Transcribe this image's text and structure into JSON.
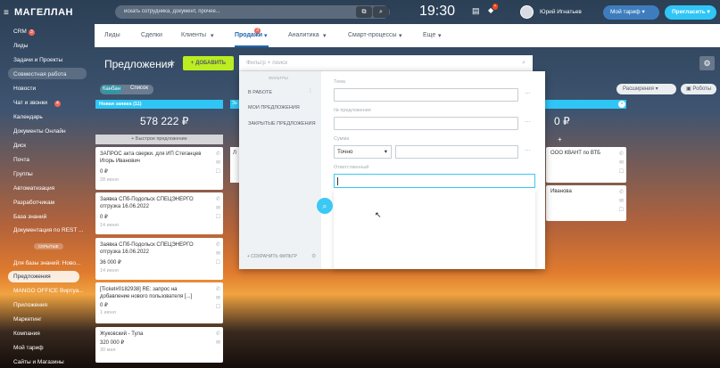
{
  "header": {
    "logo": "МАГЕЛЛАН",
    "search_placeholder": "искать сотрудника, документ, прочее...",
    "clock": "19:30",
    "user_name": "Юрий Игнатьев",
    "tariff_label": "Мой тариф",
    "invite_label": "Пригласить"
  },
  "sidebar": {
    "items": [
      {
        "label": "CRM",
        "badge": "3"
      },
      {
        "label": "Лиды"
      },
      {
        "label": "Задачи и Проекты"
      },
      {
        "label": "Совместная работа"
      },
      {
        "label": "Новости"
      },
      {
        "label": "Чат и звонки",
        "badge": "4"
      },
      {
        "label": "Календарь"
      },
      {
        "label": "Документы Онлайн"
      },
      {
        "label": "Диск"
      },
      {
        "label": "Почта"
      },
      {
        "label": "Группы"
      },
      {
        "label": "Автоматизация"
      },
      {
        "label": "Разработчикам"
      },
      {
        "label": "База знаний"
      },
      {
        "label": "Документация по REST ..."
      },
      {
        "label": "Для базы знаний: Ново..."
      },
      {
        "label": "Предложения"
      },
      {
        "label": "MANGO OFFICE Виртуа..."
      },
      {
        "label": "Приложения"
      },
      {
        "label": "Маркетинг"
      },
      {
        "label": "Компания"
      },
      {
        "label": "Мой тариф"
      },
      {
        "label": "Сайты и Магазины"
      }
    ],
    "hidden_label": "СКРЫТЫЕ"
  },
  "nav": {
    "items": [
      "Лиды",
      "Сделки",
      "Клиенты",
      "Продажи",
      "Аналитика",
      "Смарт-процессы",
      "Еще"
    ],
    "deals_badge": "3"
  },
  "page": {
    "title": "Предложения",
    "add_label": "ДОБАВИТЬ",
    "filter_placeholder": "Фильтр + поиск",
    "view_kanban": "Канбан",
    "view_list": "Список",
    "extensions_label": "Расширения",
    "robots_label": "Роботы"
  },
  "column": {
    "title": "Новая заявка",
    "count": "(11)",
    "total": "578 222 ₽",
    "quick_add": "+ Быстрое предложение"
  },
  "mid_column": {
    "title": "За",
    "card_letter": "Л"
  },
  "cards": [
    {
      "title": "ЗАПРОС акта сверки. для ИП Стеганцев Игорь Иванович",
      "price": "0 ₽",
      "date": "28 июня"
    },
    {
      "title": "Заявка СПб-Подольск СПЕЦЭНЕРГО отгрузка 16.06.2022",
      "price": "0 ₽",
      "date": "14 июня"
    },
    {
      "title": "Заявка СПб-Подольск СПЕЦЭНЕРГО отгрузка 16.06.2022",
      "price": "36 000 ₽",
      "date": "14 июня"
    },
    {
      "title": "[Ticket#0182938] RE: запрос на добавление нового пользователя [...]",
      "price": "0 ₽",
      "date": "1 июня"
    },
    {
      "title": "Жуковский - Тула",
      "price": "320 000 ₽",
      "date": "30 мая"
    }
  ],
  "right_column": {
    "total": "0 ₽",
    "cards": [
      "ООО КВАНТ по ВТБ",
      "Иванова"
    ]
  },
  "filter": {
    "presets_title": "ФИЛЬТРЫ",
    "presets": [
      "В РАБОТЕ",
      "МОИ ПРЕДЛОЖЕНИЯ",
      "ЗАКРЫТЫЕ ПРЕДЛОЖЕНИЯ"
    ],
    "save_label": "+ СОХРАНИТЬ ФИЛЬТР",
    "fields": {
      "topic": "Тема",
      "number": "№ предложения",
      "sum": "Сумма",
      "sum_mode": "Точно",
      "responsible": "Ответственный"
    }
  }
}
